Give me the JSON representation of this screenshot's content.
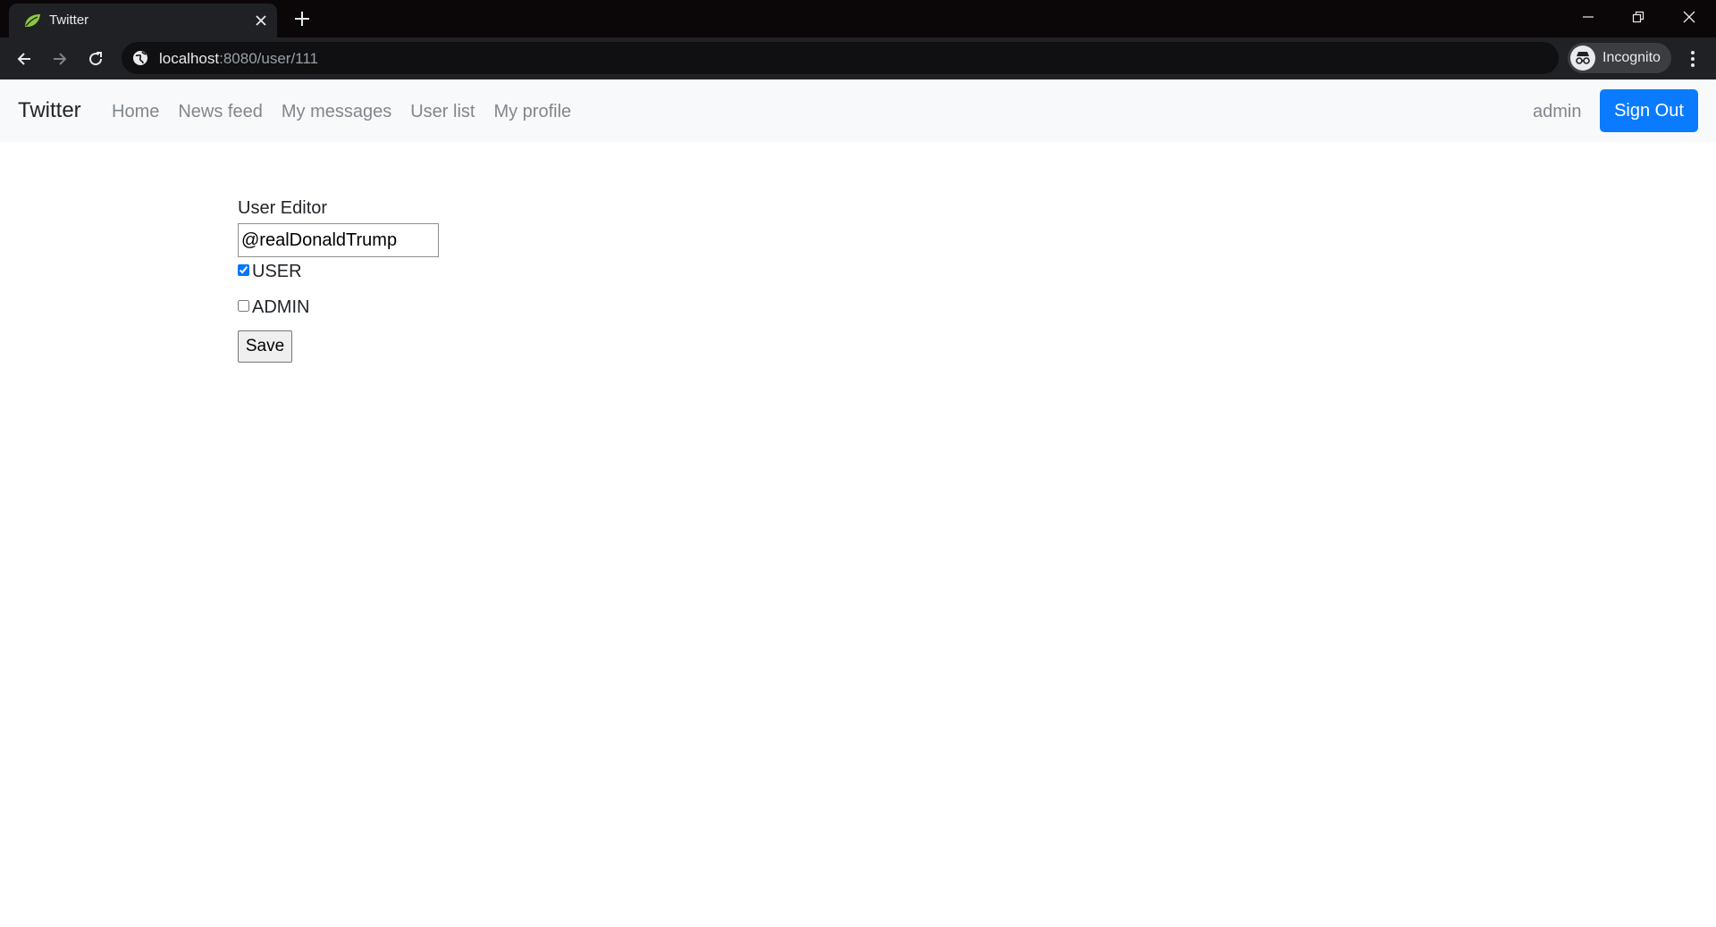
{
  "browser": {
    "tab_title": "Twitter",
    "url_host": "localhost",
    "url_rest": ":8080/user/111",
    "profile_label": "Incognito",
    "accent_favicon": "#8cc63f"
  },
  "navbar": {
    "brand": "Twitter",
    "links": [
      "Home",
      "News feed",
      "My messages",
      "User list",
      "My profile"
    ],
    "username": "admin",
    "signout_label": "Sign Out",
    "signout_color": "#0a7bff"
  },
  "editor": {
    "title": "User Editor",
    "username_value": "@realDonaldTrump",
    "roles": [
      {
        "label": "USER",
        "checked": true
      },
      {
        "label": "ADMIN",
        "checked": false
      }
    ],
    "save_label": "Save"
  }
}
